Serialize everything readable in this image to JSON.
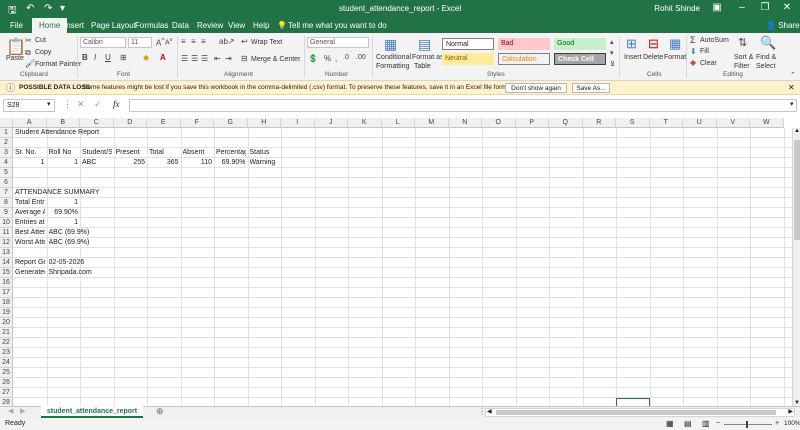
{
  "window": {
    "title": "student_attendance_report - Excel",
    "user": "Rohit Shinde"
  },
  "tabs": [
    "File",
    "Home",
    "Insert",
    "Page Layout",
    "Formulas",
    "Data",
    "Review",
    "View",
    "Help"
  ],
  "tell_me": "Tell me what you want to do",
  "share": "Share",
  "ribbon": {
    "clipboard": {
      "paste": "Paste",
      "cut": "Cut",
      "copy": "Copy",
      "format_painter": "Format Painter",
      "label": "Clipboard"
    },
    "font": {
      "name": "Calibri",
      "size": "11",
      "label": "Font"
    },
    "alignment": {
      "wrap": "Wrap Text",
      "merge": "Merge & Center",
      "label": "Alignment"
    },
    "number": {
      "format": "General",
      "label": "Number"
    },
    "styles": {
      "conditional": [
        "Conditional",
        "Formatting"
      ],
      "format_table": [
        "Format as",
        "Table"
      ],
      "normal": "Normal",
      "bad": "Bad",
      "good": "Good",
      "neutral": "Neutral",
      "calculation": "Calculation",
      "check_cell": "Check Cell",
      "label": "Styles"
    },
    "cells": {
      "insert": "Insert",
      "delete": "Delete",
      "format": "Format",
      "label": "Cells"
    },
    "editing": {
      "autosum": "AutoSum",
      "fill": "Fill",
      "clear": "Clear",
      "sort": [
        "Sort &",
        "Filter"
      ],
      "find": [
        "Find &",
        "Select"
      ],
      "label": "Editing"
    }
  },
  "infobar": {
    "title": "POSSIBLE DATA LOSS",
    "message": "Some features might be lost if you save this workbook in the comma-delimited (.csv) format. To preserve these features, save it in an Excel file format.",
    "dont_show": "Don't show again",
    "save_as": "Save As..."
  },
  "name_box": "S28",
  "columns": [
    "A",
    "B",
    "C",
    "D",
    "E",
    "F",
    "G",
    "H",
    "I",
    "J",
    "K",
    "L",
    "M",
    "N",
    "O",
    "P",
    "Q",
    "R",
    "S",
    "T",
    "U",
    "V",
    "W"
  ],
  "row_count": 28,
  "cells": [
    {
      "col": "A",
      "row": 1,
      "v": "Student Attendance Report"
    },
    {
      "col": "A",
      "row": 3,
      "v": "Sr. No."
    },
    {
      "col": "B",
      "row": 3,
      "v": "Roll No"
    },
    {
      "col": "C",
      "row": 3,
      "v": "Student/S"
    },
    {
      "col": "D",
      "row": 3,
      "v": "Present"
    },
    {
      "col": "E",
      "row": 3,
      "v": "Total"
    },
    {
      "col": "F",
      "row": 3,
      "v": "Absent"
    },
    {
      "col": "G",
      "row": 3,
      "v": "Percentage"
    },
    {
      "col": "H",
      "row": 3,
      "v": "Status"
    },
    {
      "col": "A",
      "row": 4,
      "v": "1",
      "num": true
    },
    {
      "col": "B",
      "row": 4,
      "v": "1",
      "num": true
    },
    {
      "col": "C",
      "row": 4,
      "v": "ABC"
    },
    {
      "col": "D",
      "row": 4,
      "v": "255",
      "num": true
    },
    {
      "col": "E",
      "row": 4,
      "v": "365",
      "num": true
    },
    {
      "col": "F",
      "row": 4,
      "v": "110",
      "num": true
    },
    {
      "col": "G",
      "row": 4,
      "v": "69.90%",
      "num": true
    },
    {
      "col": "H",
      "row": 4,
      "v": "Warning"
    },
    {
      "col": "A",
      "row": 7,
      "v": "ATTENDANCE SUMMARY"
    },
    {
      "col": "A",
      "row": 8,
      "v": "Total Entri"
    },
    {
      "col": "B",
      "row": 8,
      "v": "1",
      "num": true
    },
    {
      "col": "A",
      "row": 9,
      "v": "Average At"
    },
    {
      "col": "B",
      "row": 9,
      "v": "69.90%",
      "num": true
    },
    {
      "col": "A",
      "row": 10,
      "v": "Entries at l"
    },
    {
      "col": "B",
      "row": 10,
      "v": "1",
      "num": true
    },
    {
      "col": "A",
      "row": 11,
      "v": "Best Atten"
    },
    {
      "col": "B",
      "row": 11,
      "v": "ABC (69.9%)"
    },
    {
      "col": "A",
      "row": 12,
      "v": "Worst Atte"
    },
    {
      "col": "B",
      "row": 12,
      "v": "ABC (69.9%)"
    },
    {
      "col": "A",
      "row": 14,
      "v": "Report Ge"
    },
    {
      "col": "B",
      "row": 14,
      "v": "02-05-2026"
    },
    {
      "col": "A",
      "row": 15,
      "v": "Generated"
    },
    {
      "col": "B",
      "row": 15,
      "v": "Shripada.com"
    }
  ],
  "sheet_tab": "student_attendance_report",
  "status": {
    "ready": "Ready",
    "zoom": "100%"
  }
}
